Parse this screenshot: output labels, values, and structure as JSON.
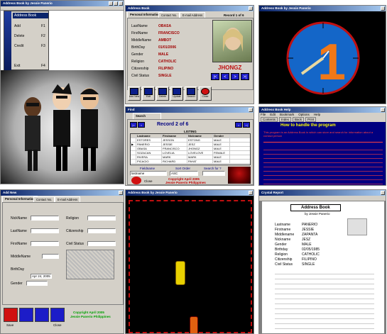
{
  "w1": {
    "title": "Address Book by Jessie Panerio",
    "menu": [
      "Address Book",
      "Add",
      "Delete",
      "Credit",
      "Exit"
    ],
    "menu_shortcuts": [
      "",
      "F1",
      "F2",
      "F3",
      "F4"
    ],
    "caption": "Address Book by Jessie Panerio"
  },
  "w2": {
    "title": "Address Book",
    "tabs": [
      "Personal Information",
      "Contact No.",
      "E-mail Address"
    ],
    "record": "Record 1 of 6",
    "labels": [
      "LastName",
      "FirstName",
      "MiddleName",
      "BirthDay",
      "Gender",
      "Religion",
      "Citizenship",
      "Civil Status"
    ],
    "values": [
      "OBASA",
      "FRANCISCO",
      "AMBOT",
      "01/01/2006",
      "MALE",
      "CATHOLIC",
      "FILIPINO",
      "SINGLE"
    ],
    "photo_name": "JHONGZ",
    "nav": [
      "|<",
      "<",
      ">",
      ">|"
    ],
    "toolbar": [
      "Add New",
      "Edit",
      "Delete",
      "Update",
      "Search",
      "Close"
    ]
  },
  "w3": {
    "title": "Address Book by Jessie Panerio",
    "digit": "1"
  },
  "w4": {
    "title": "Find",
    "tab": "Search",
    "record": "Record 2 of 6",
    "listing": "LISTING",
    "columns": [
      "",
      "Lastname",
      "Firstname",
      "Nickname",
      "Gender"
    ],
    "rows": [
      [
        "",
        "ESTORES",
        "JESSON",
        "ESTONG",
        "MALE"
      ],
      [
        "▶",
        "PANERIO",
        "JESSIE",
        "JESZ",
        "MALE"
      ],
      [
        "",
        "OBASA",
        "FRANCISCO",
        "JHONGZ",
        "MALE"
      ],
      [
        "",
        "SOZACAN",
        "LOVELIA",
        "LOVELOVE",
        "FEMALE"
      ],
      [
        "",
        "RIVERA",
        "MARK",
        "MARK",
        "MALE"
      ],
      [
        "",
        "PICACIO",
        "RICHARD",
        "PAYAT",
        "MALE"
      ]
    ],
    "field_label": "Fieldname",
    "field_value": "lastname",
    "sort_label": "Sort Order",
    "sort_value": "ASC",
    "search_label": "Search for ?",
    "close": "Close",
    "copyright": "Copyright April 2005",
    "author": "Jessie Panerio Philippines"
  },
  "w5": {
    "title": "Address Book Help",
    "menu": [
      "File",
      "Edit",
      "Bookmark",
      "Options",
      "Help"
    ],
    "buttons": [
      "Contents",
      "Index",
      "Back",
      "Print"
    ],
    "heading": "How to handle the program",
    "text": "This program is an Address Book in which can store and search for information about a contact person"
  },
  "w6": {
    "title": "Add New",
    "tabs": [
      "Personal Information",
      "Contact No.",
      "E-mail Address"
    ],
    "labels_left": [
      "NickName",
      "LastName",
      "FirstName",
      "MiddleName",
      "BirthDay",
      "Gender"
    ],
    "labels_right": [
      "Religion",
      "Citizenship",
      "Civil Status"
    ],
    "date": "Apr 24, 2005",
    "buttons": [
      "Save",
      "",
      "",
      "Close"
    ],
    "copyright": "Copyright April 2005",
    "author": "Jessie Panerio Philippines"
  },
  "w7": {
    "title": "Address Book by Jessie Panerio"
  },
  "w8": {
    "title": "Crystal Report",
    "report_title": "Address Book",
    "sub": "by Jessie Panerio",
    "fields": [
      "Lastname",
      "Firstname",
      "Middlename",
      "Nickname",
      "Gender",
      "Birthday",
      "Religion",
      "Citizenship",
      "Civil Status"
    ],
    "values": [
      "PANERIO",
      "JESSIE",
      "ZAPANTA",
      "JESZ",
      "MALE",
      "02/05/1985",
      "CATHOLIC",
      "FILIPINO",
      "SINGLE"
    ]
  }
}
